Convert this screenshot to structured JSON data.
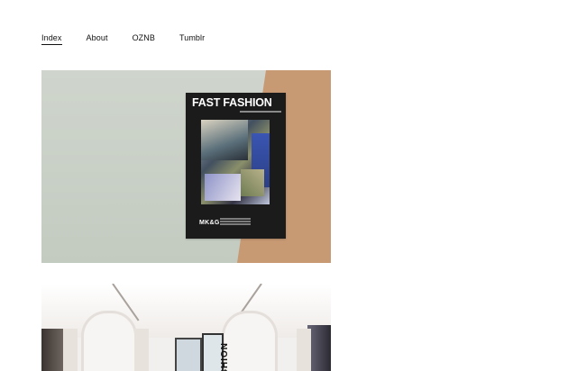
{
  "nav": {
    "items": [
      {
        "label": "Index",
        "active": true
      },
      {
        "label": "About",
        "active": false
      },
      {
        "label": "OZNB",
        "active": false
      },
      {
        "label": "Tumblr",
        "active": false
      }
    ]
  },
  "projects": [
    {
      "poster_title": "FAST FASHION",
      "poster_logo": "MK&G",
      "colors": {
        "wall": "#c8cfc6",
        "accent_wall": "#c79a74",
        "poster": "#1b1b1b"
      }
    },
    {
      "vertical_text": "FASHION",
      "colors": {
        "wall": "#f2f0ee"
      }
    }
  ]
}
